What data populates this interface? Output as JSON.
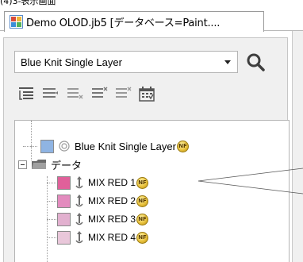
{
  "page_caption": "(4)3-表示画面",
  "window": {
    "tab_title": "Demo OLOD.jb5 [データベース=Paint...."
  },
  "search": {
    "selected_value": "Blue Knit Single Layer"
  },
  "toolbar": {
    "icons": [
      "list-indent-icon",
      "list-view-icon",
      "list-remove-icon",
      "list-delete-icon",
      "list-clear-icon",
      "calendar-grid-icon"
    ]
  },
  "tree": {
    "root": {
      "label": "Blue Knit Single Layer",
      "badge": "NF",
      "color": "#8fb4e3"
    },
    "folder": {
      "label": "データ"
    },
    "items": [
      {
        "label": "MIX RED 1",
        "badge": "NF",
        "color": "#e0609a"
      },
      {
        "label": "MIX RED 2",
        "badge": "NF",
        "color": "#e38bbe"
      },
      {
        "label": "MIX RED 3",
        "badge": "NF",
        "color": "#e2b0cf"
      },
      {
        "label": "MIX RED 4",
        "badge": "NF",
        "color": "#e9c7da"
      }
    ]
  }
}
